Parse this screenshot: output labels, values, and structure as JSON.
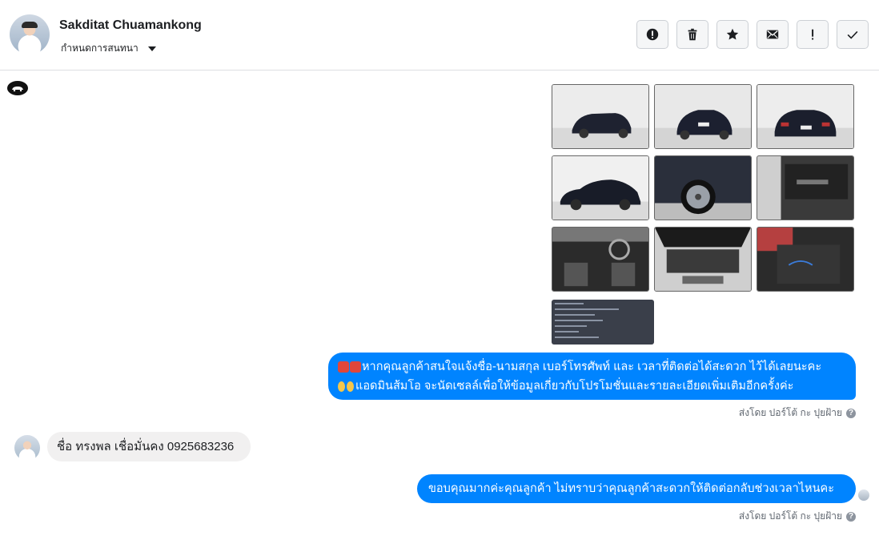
{
  "header": {
    "contact_name": "Sakditat Chuamankong",
    "assign_label": "กำหนดการสนทนา",
    "actions": [
      {
        "name": "spam-button",
        "icon": "alert-circle-icon"
      },
      {
        "name": "delete-button",
        "icon": "trash-icon"
      },
      {
        "name": "star-button",
        "icon": "star-icon"
      },
      {
        "name": "mark-unread-button",
        "icon": "envelope-icon"
      },
      {
        "name": "important-button",
        "icon": "exclamation-icon"
      },
      {
        "name": "done-button",
        "icon": "check-icon"
      }
    ]
  },
  "messages": {
    "car_photos_count": 10,
    "outgoing_1_line1": "หากคุณลูกค้าสนใจแจ้งชื่อ-นามสกุล เบอร์โทรศัพท์ และ เวลาที่ติดต่อได้สะดวก ไว้ได้เลยนะคะ",
    "outgoing_1_line2": "แอดมินส้มโอ จะนัดเซลล์เพื่อให้ข้อมูลเกี่ยวกับโปรโมชั่นและรายละเอียดเพิ่มเติมอีกครั้งค่ะ",
    "sent_by_1": "ส่งโดย ปอร์โต้ กะ ปุยฝ้าย",
    "incoming_1": "ชื่อ ทรงพล เชื่อมั่นคง 0925683236",
    "outgoing_2": "ขอบคุณมากค่ะคุณลูกค้า ไม่ทราบว่าคุณลูกค้าสะดวกให้ติดต่อกลับช่วงเวลาไหนคะ",
    "sent_by_2": "ส่งโดย ปอร์โต้ กะ ปุยฝ้าย",
    "help_glyph": "?"
  },
  "colors": {
    "outgoing_bubble": "#0084ff",
    "incoming_bubble": "#f1f0f0",
    "border": "#dddfe2"
  }
}
